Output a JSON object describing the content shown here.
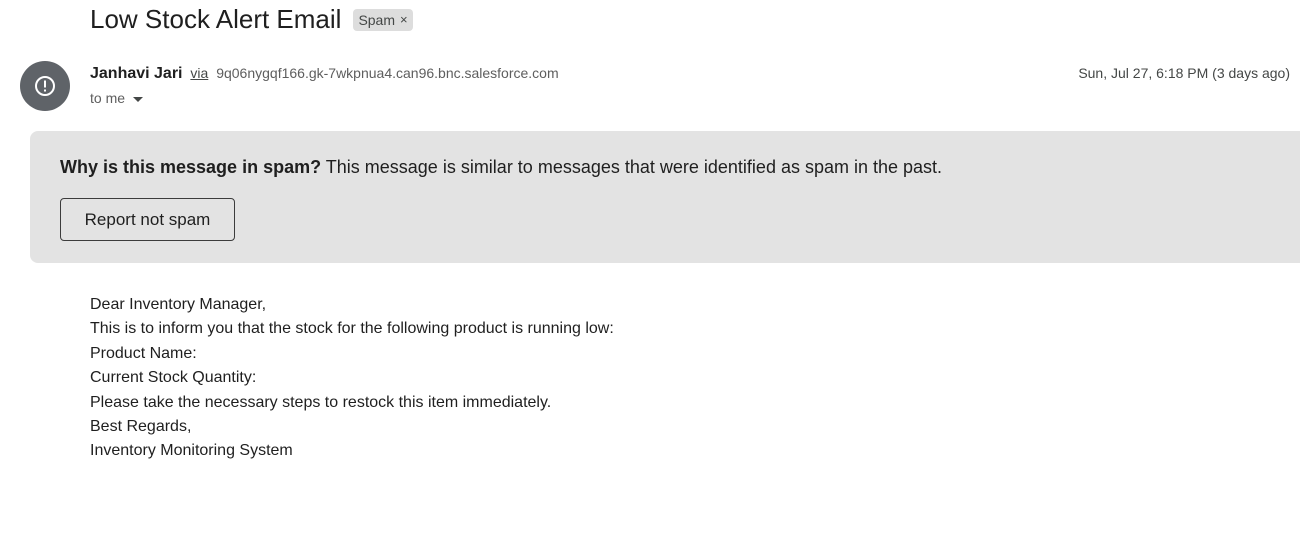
{
  "email": {
    "subject": "Low Stock Alert Email",
    "label": {
      "text": "Spam",
      "remove_glyph": "×"
    },
    "sender": {
      "name": "Janhavi Jari",
      "via_label": "via",
      "via_address": "9q06nygqf166.gk-7wkpnua4.can96.bnc.salesforce.com",
      "avatar_icon": "alert-circle-icon"
    },
    "recipient_label": "to me",
    "date": "Sun, Jul 27, 6:18 PM (3 days ago)",
    "spam_banner": {
      "question": "Why is this message in spam?",
      "explanation": " This message is similar to messages that were identified as spam in the past.",
      "button_label": "Report not spam"
    },
    "body_lines": [
      "Dear Inventory Manager,",
      "This is to inform you that the stock for the following product is running low:",
      "Product Name:",
      "Current Stock Quantity:",
      "Please take the necessary steps to restock this item immediately.",
      "Best Regards,",
      "Inventory Monitoring System"
    ]
  },
  "colors": {
    "banner_bg": "#e3e3e3",
    "avatar_bg": "#5f6368",
    "chip_bg": "#dddddd",
    "text": "#1f1f1f"
  }
}
